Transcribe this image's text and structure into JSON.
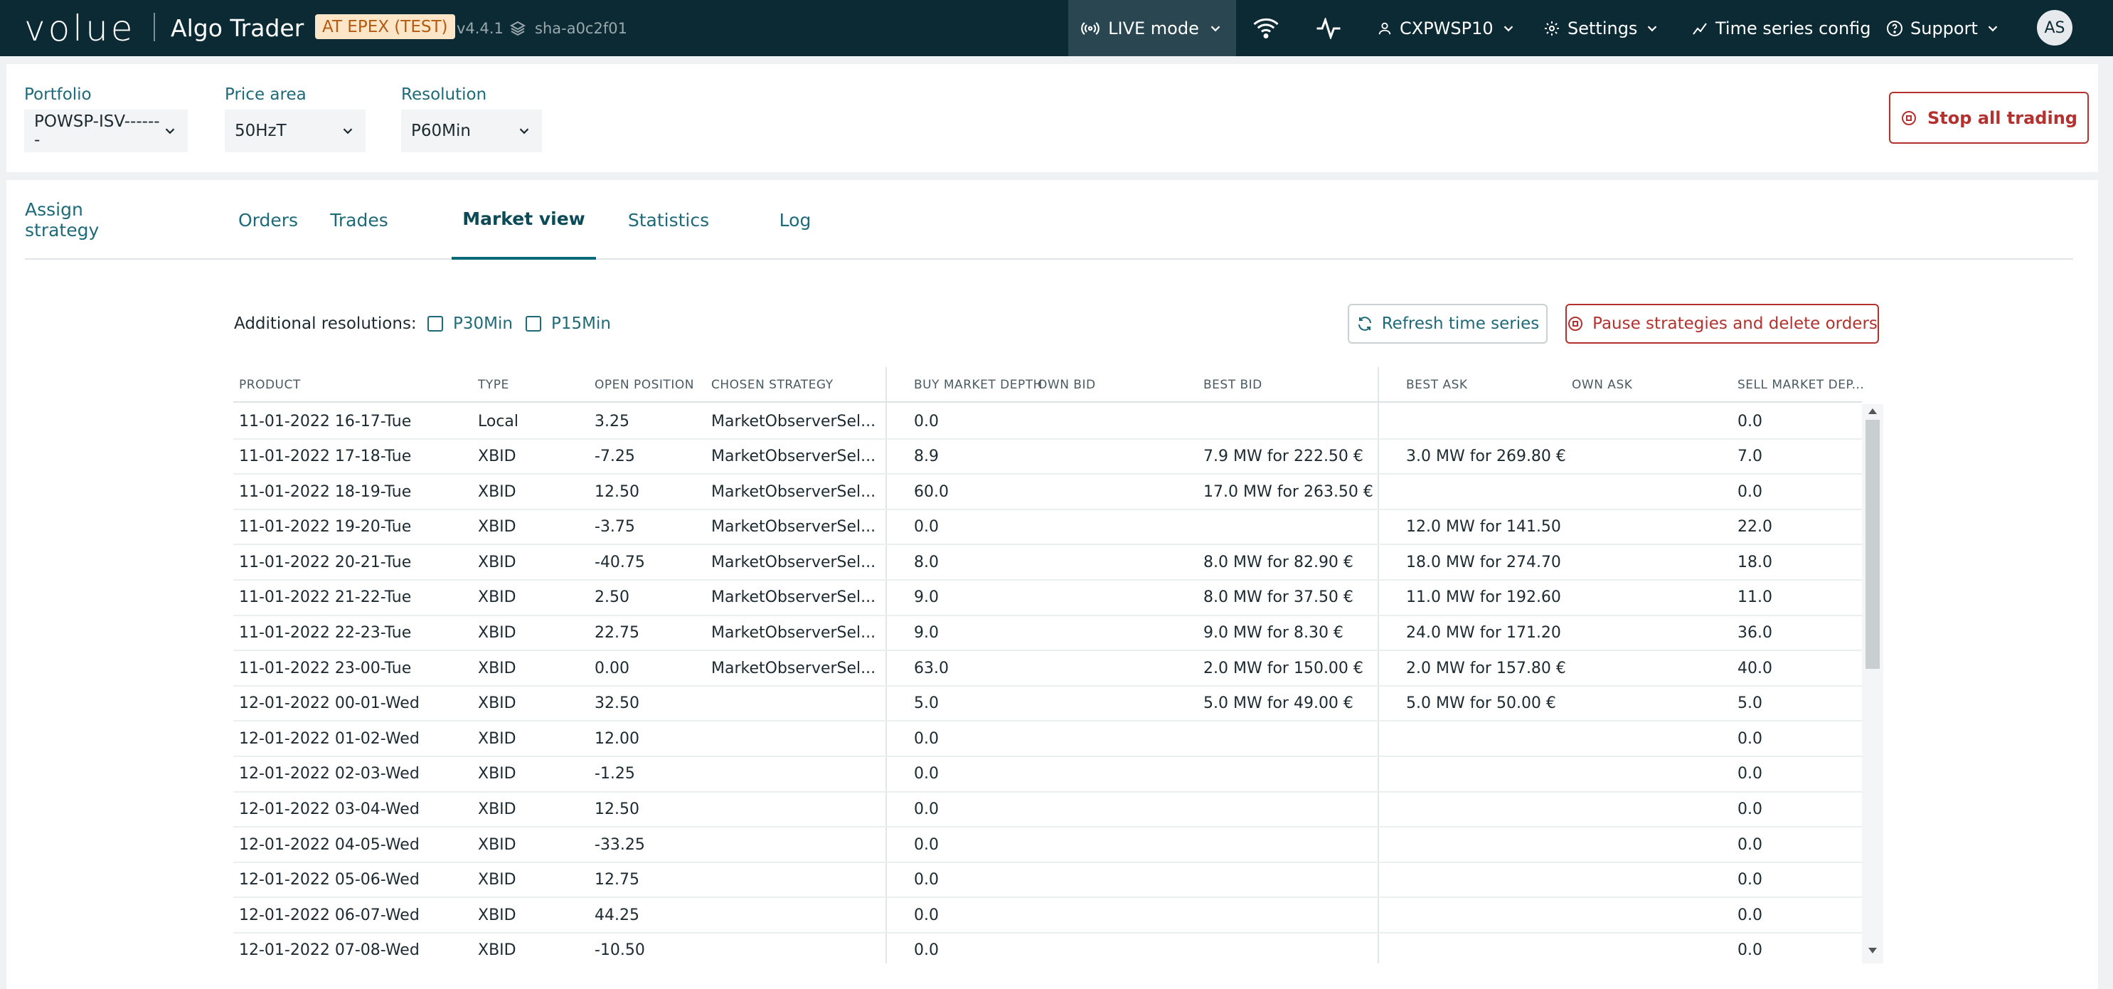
{
  "header": {
    "logo": "volue",
    "app_name": "Algo Trader",
    "environment": "AT EPEX (TEST)",
    "version": "v4.4.1",
    "sha": "sha-a0c2f01",
    "live_mode_label": "LIVE mode",
    "user": "CXPWSP10",
    "settings_label": "Settings",
    "time_series_label": "Time series config",
    "support_label": "Support",
    "avatar_initials": "AS"
  },
  "selectors": {
    "portfolio": {
      "label": "Portfolio",
      "value": "POWSP-ISV-------"
    },
    "price_area": {
      "label": "Price area",
      "value": "50HzT"
    },
    "resolution": {
      "label": "Resolution",
      "value": "P60Min"
    },
    "stop_button": "Stop all trading"
  },
  "tabs": [
    {
      "label": "Assign strategy",
      "active": false
    },
    {
      "label": "Orders",
      "active": false
    },
    {
      "label": "Trades",
      "active": false
    },
    {
      "label": "Market view",
      "active": true
    },
    {
      "label": "Statistics",
      "active": false
    },
    {
      "label": "Log",
      "active": false
    }
  ],
  "toolbar": {
    "additional_label": "Additional resolutions:",
    "checkboxes": [
      {
        "label": "P30Min",
        "checked": false
      },
      {
        "label": "P15Min",
        "checked": false
      }
    ],
    "refresh_button": "Refresh time series",
    "pause_button": "Pause strategies and delete orders"
  },
  "table": {
    "columns": [
      "PRODUCT",
      "TYPE",
      "OPEN POSITION",
      "CHOSEN STRATEGY",
      "BUY MARKET DEPTH",
      "OWN BID",
      "BEST BID",
      "BEST ASK",
      "OWN ASK",
      "SELL MARKET DEP..."
    ],
    "rows": [
      [
        "11-01-2022 16-17-Tue",
        "Local",
        "3.25",
        "MarketObserverSel...",
        "0.0",
        "",
        "",
        "",
        "",
        "0.0"
      ],
      [
        "11-01-2022 17-18-Tue",
        "XBID",
        "-7.25",
        "MarketObserverSel...",
        "8.9",
        "",
        "7.9 MW for 222.50 €",
        "3.0 MW for 269.80 €",
        "",
        "7.0"
      ],
      [
        "11-01-2022 18-19-Tue",
        "XBID",
        "12.50",
        "MarketObserverSel...",
        "60.0",
        "",
        "17.0 MW for 263.50 €",
        "",
        "",
        "0.0"
      ],
      [
        "11-01-2022 19-20-Tue",
        "XBID",
        "-3.75",
        "MarketObserverSel...",
        "0.0",
        "",
        "",
        "12.0 MW for 141.50 €",
        "",
        "22.0"
      ],
      [
        "11-01-2022 20-21-Tue",
        "XBID",
        "-40.75",
        "MarketObserverSel...",
        "8.0",
        "",
        "8.0 MW for 82.90 €",
        "18.0 MW for 274.70 €",
        "",
        "18.0"
      ],
      [
        "11-01-2022 21-22-Tue",
        "XBID",
        "2.50",
        "MarketObserverSel...",
        "9.0",
        "",
        "8.0 MW for 37.50 €",
        "11.0 MW for 192.60 €",
        "",
        "11.0"
      ],
      [
        "11-01-2022 22-23-Tue",
        "XBID",
        "22.75",
        "MarketObserverSel...",
        "9.0",
        "",
        "9.0 MW for 8.30 €",
        "24.0 MW for 171.20 €",
        "",
        "36.0"
      ],
      [
        "11-01-2022 23-00-Tue",
        "XBID",
        "0.00",
        "MarketObserverSel...",
        "63.0",
        "",
        "2.0 MW for 150.00 €",
        "2.0 MW for 157.80 €",
        "",
        "40.0"
      ],
      [
        "12-01-2022 00-01-Wed",
        "XBID",
        "32.50",
        "",
        "5.0",
        "",
        "5.0 MW for 49.00 €",
        "5.0 MW for 50.00 €",
        "",
        "5.0"
      ],
      [
        "12-01-2022 01-02-Wed",
        "XBID",
        "12.00",
        "",
        "0.0",
        "",
        "",
        "",
        "",
        "0.0"
      ],
      [
        "12-01-2022 02-03-Wed",
        "XBID",
        "-1.25",
        "",
        "0.0",
        "",
        "",
        "",
        "",
        "0.0"
      ],
      [
        "12-01-2022 03-04-Wed",
        "XBID",
        "12.50",
        "",
        "0.0",
        "",
        "",
        "",
        "",
        "0.0"
      ],
      [
        "12-01-2022 04-05-Wed",
        "XBID",
        "-33.25",
        "",
        "0.0",
        "",
        "",
        "",
        "",
        "0.0"
      ],
      [
        "12-01-2022 05-06-Wed",
        "XBID",
        "12.75",
        "",
        "0.0",
        "",
        "",
        "",
        "",
        "0.0"
      ],
      [
        "12-01-2022 06-07-Wed",
        "XBID",
        "44.25",
        "",
        "0.0",
        "",
        "",
        "",
        "",
        "0.0"
      ],
      [
        "12-01-2022 07-08-Wed",
        "XBID",
        "-10.50",
        "",
        "0.0",
        "",
        "",
        "",
        "",
        "0.0"
      ]
    ]
  },
  "icons": {
    "live": "broadcast-icon",
    "wifi": "wifi-icon",
    "activity": "activity-icon",
    "user": "user-icon",
    "settings": "gear-icon",
    "timeseries": "chart-line-icon",
    "support": "help-circle-icon",
    "stop": "stop-circle-icon",
    "refresh": "refresh-icon",
    "stack": "layers-icon"
  },
  "colors": {
    "header_bg": "#0c2a33",
    "accent": "#1f6a78",
    "danger": "#b3312e",
    "env_badge_bg": "#fde6c8"
  }
}
